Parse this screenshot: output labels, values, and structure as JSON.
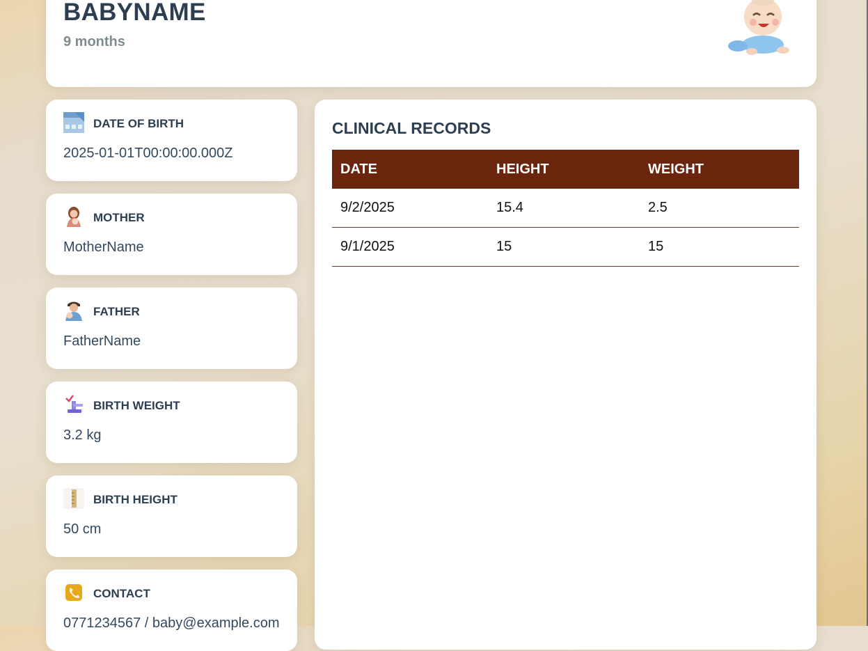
{
  "profile": {
    "name": "BABYNAME",
    "age": "9 months",
    "avatar_icon": "crawling-baby-icon"
  },
  "info_cards": [
    {
      "label": "DATE OF BIRTH",
      "value": "2025-01-01T00:00:00.000Z",
      "icon": "calendar-icon"
    },
    {
      "label": "MOTHER",
      "value": "MotherName",
      "icon": "mother-icon"
    },
    {
      "label": "FATHER",
      "value": "FatherName",
      "icon": "father-icon"
    },
    {
      "label": "BIRTH WEIGHT",
      "value": "3.2 kg",
      "icon": "scale-icon"
    },
    {
      "label": "BIRTH HEIGHT",
      "value": "50 cm",
      "icon": "ruler-icon"
    },
    {
      "label": "CONTACT",
      "value": "0771234567 / baby@example.com",
      "icon": "phone-icon"
    }
  ],
  "records": {
    "title": "CLINICAL RECORDS",
    "columns": [
      "DATE",
      "HEIGHT",
      "WEIGHT"
    ],
    "rows": [
      [
        "9/2/2025",
        "15.4",
        "2.5"
      ],
      [
        "9/1/2025",
        "15",
        "15"
      ]
    ]
  },
  "colors": {
    "table_header": "#6b250c",
    "heading_text": "#2c3e50",
    "muted_text": "#7f8c8d"
  }
}
